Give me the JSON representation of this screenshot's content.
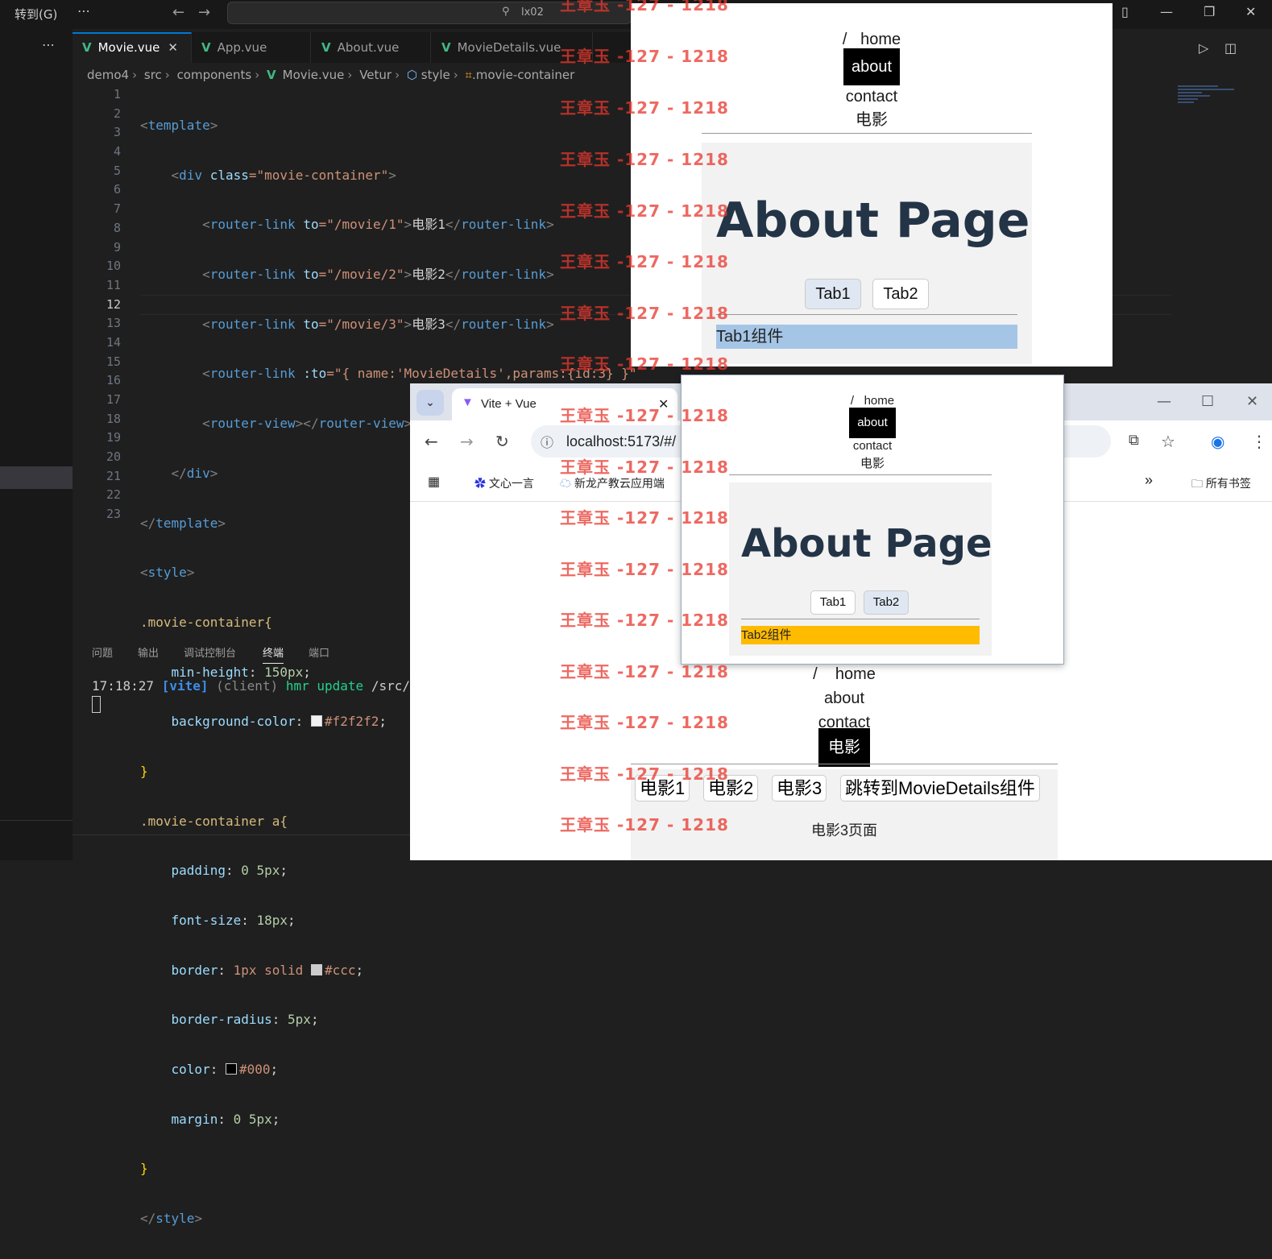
{
  "vscode": {
    "goto_menu": "转到(G)",
    "more": "⋯",
    "back": "←",
    "forward": "→",
    "search_placeholder": "lx02",
    "tabs": [
      {
        "label": "Movie.vue",
        "close": "✕"
      },
      {
        "label": "App.vue"
      },
      {
        "label": "About.vue"
      },
      {
        "label": "MovieDetails.vue"
      }
    ],
    "breadcrumb": [
      "demo4",
      "src",
      "components",
      "Movie.vue",
      "Vetur",
      "style",
      ".movie-container"
    ],
    "line_numbers": [
      "1",
      "2",
      "3",
      "4",
      "5",
      "6",
      "7",
      "8",
      "9",
      "10",
      "11",
      "12",
      "13",
      "14",
      "15",
      "16",
      "17",
      "18",
      "19",
      "20",
      "21",
      "22",
      "23"
    ],
    "current_line": "12",
    "code": {
      "l1": [
        "<",
        "template",
        ">"
      ],
      "l2": [
        "<",
        "div",
        "class",
        "=\"movie-container\"",
        ">"
      ],
      "l3": [
        "<",
        "router-link",
        "to",
        "=\"/movie/1\"",
        ">",
        "电影1",
        "</",
        "router-link",
        ">"
      ],
      "l4": [
        "<",
        "router-link",
        "to",
        "=\"/movie/2\"",
        ">",
        "电影2",
        "</",
        "router-link",
        ">"
      ],
      "l5": [
        "<",
        "router-link",
        "to",
        "=\"/movie/3\"",
        ">",
        "电影3",
        "</",
        "router-link",
        ">"
      ],
      "l6": [
        "<",
        "router-link",
        ":to",
        "=\"{ name:'MovieDetails',params:{id:3} }\""
      ],
      "l7": [
        "<",
        "router-view",
        "></",
        "router-view",
        ">"
      ],
      "l8": [
        "</",
        "div",
        ">"
      ],
      "l9": [
        "</",
        "template",
        ">"
      ],
      "l10": [
        "<",
        "style",
        ">"
      ],
      "l11": ".movie-container{",
      "l12": [
        "min-height",
        ": ",
        "150px",
        ";"
      ],
      "l13": [
        "background-color",
        ": ",
        "#f2f2f2",
        ";"
      ],
      "l14": "}",
      "l15": ".movie-container a{",
      "l16": [
        "padding",
        ": ",
        "0 5px",
        ";"
      ],
      "l17": [
        "font-size",
        ": ",
        "18px",
        ";"
      ],
      "l18": [
        "border",
        ": ",
        "1px solid",
        "#ccc",
        ";"
      ],
      "l19": [
        "border-radius",
        ": ",
        "5px",
        ";"
      ],
      "l20": [
        "color",
        ": ",
        "#000",
        ";"
      ],
      "l21": [
        "margin",
        ": ",
        "0 5px",
        ";"
      ],
      "l22": "}",
      "l23": [
        "</",
        "style",
        ">"
      ]
    },
    "panel_tabs": [
      "问题",
      "输出",
      "调试控制台",
      "终端",
      "端口"
    ],
    "active_panel_tab": "终端",
    "terminal": {
      "time": "17:18:27",
      "tag": "[vite]",
      "client": "(client)",
      "msg": "hmr update",
      "path": "/src/com"
    }
  },
  "preview1": {
    "nav": [
      "/",
      "home",
      "about",
      "contact",
      "电影"
    ],
    "active": "about",
    "title": "About Page",
    "tabs": [
      "Tab1",
      "Tab2"
    ],
    "selected_tab": "Tab1",
    "content": "Tab1组件",
    "content_color": "#a4c5e6"
  },
  "chrome": {
    "tab_title": "Vite + Vue",
    "url": "localhost:5173/#/",
    "bookmarks": [
      "文心一言",
      "新龙产教云应用端"
    ],
    "bookmarks_folder": "所有书签",
    "more_bookmarks": "»"
  },
  "preview2": {
    "nav": [
      "/",
      "home",
      "about",
      "contact",
      "电影"
    ],
    "active": "about",
    "title": "About Page",
    "tabs": [
      "Tab1",
      "Tab2"
    ],
    "selected_tab": "Tab2",
    "content": "Tab2组件",
    "content_color": "#ffbb00"
  },
  "movie_page": {
    "nav": [
      "/",
      "home",
      "about",
      "contact",
      "电影"
    ],
    "active": "电影",
    "links": [
      "电影1",
      "电影2",
      "电影3",
      "跳转到MovieDetails组件"
    ],
    "page_text": "电影3页面"
  },
  "watermark": "王章玉 -127 - 1218",
  "colors": {
    "vscode_bg": "#1f1f1f",
    "accent": "#0078d4",
    "vue_green": "#41b883",
    "watermark": "#e8382e"
  }
}
